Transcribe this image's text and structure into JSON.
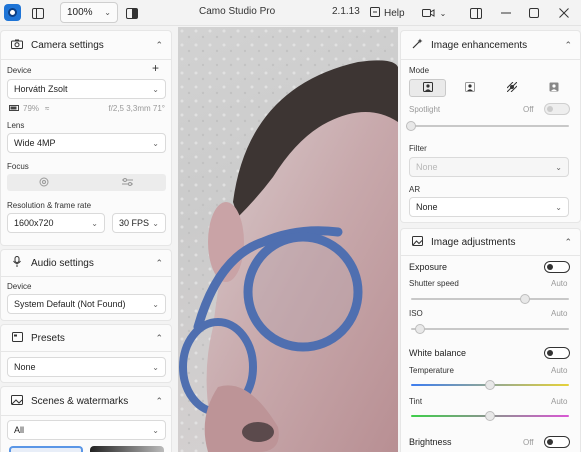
{
  "window": {
    "title": "Camo Studio Pro",
    "version": "2.1.13",
    "help_label": "Help",
    "zoom_value": "100%"
  },
  "icons": {
    "app": "camo-app-icon",
    "sidebar_toggle": "sidebar-icon",
    "zoom_chevron": "chevron-down-icon",
    "compare": "split-view-icon",
    "help": "question-icon",
    "record": "video-camera-icon",
    "layout": "panel-icon",
    "minimize": "minimize-icon",
    "maximize": "maximize-icon",
    "close": "close-icon"
  },
  "camera_settings": {
    "title": "Camera settings",
    "device_label": "Device",
    "add": "+",
    "device_value": "Horváth Zsolt",
    "battery": "79%",
    "lens_info": "f/2,5 3,3mm 71°",
    "lens_label": "Lens",
    "lens_value": "Wide 4MP",
    "focus_label": "Focus",
    "resolution_label": "Resolution & frame rate",
    "resolution_value": "1600x720",
    "fps_value": "30 FPS"
  },
  "audio_settings": {
    "title": "Audio settings",
    "device_label": "Device",
    "device_value": "System Default (Not Found)"
  },
  "presets": {
    "title": "Presets",
    "value": "None"
  },
  "scenes": {
    "title": "Scenes & watermarks",
    "value": "All"
  },
  "image_enhancements": {
    "title": "Image enhancements",
    "mode_label": "Mode",
    "spotlight_label": "Spotlight",
    "spotlight_state": "Off",
    "spotlight_level": 0,
    "filter_label": "Filter",
    "filter_value": "None",
    "ar_label": "AR",
    "ar_value": "None"
  },
  "image_adjustments": {
    "title": "Image adjustments",
    "exposure_label": "Exposure",
    "shutter_label": "Shutter speed",
    "shutter_state": "Auto",
    "shutter_level": 0.72,
    "iso_label": "ISO",
    "iso_state": "Auto",
    "iso_level": 0.06,
    "white_balance_label": "White balance",
    "temperature_label": "Temperature",
    "temperature_state": "Auto",
    "temperature_level": 0.5,
    "tint_label": "Tint",
    "tint_state": "Auto",
    "tint_level": 0.5,
    "brightness_label": "Brightness",
    "brightness_state": "Off"
  }
}
